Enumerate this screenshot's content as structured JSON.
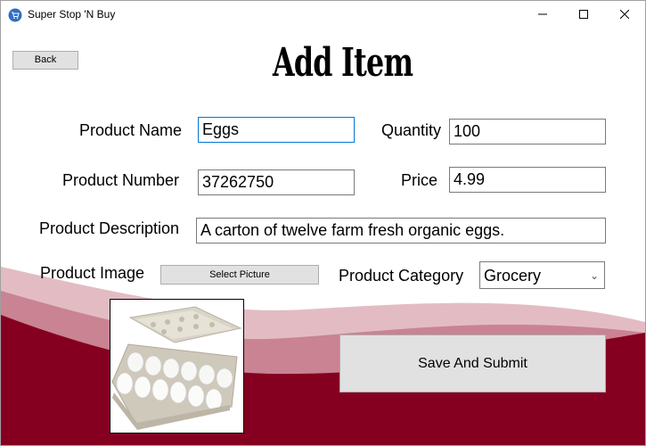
{
  "window": {
    "title": "Super Stop 'N Buy",
    "controls": [
      "minimize",
      "maximize",
      "close"
    ]
  },
  "header": {
    "back_label": "Back",
    "title": "Add Item"
  },
  "form": {
    "product_name": {
      "label": "Product Name",
      "value": "Eggs"
    },
    "quantity": {
      "label": "Quantity",
      "value": "100"
    },
    "product_number": {
      "label": "Product Number",
      "value": "37262750"
    },
    "price": {
      "label": "Price",
      "value": "4.99"
    },
    "product_description": {
      "label": "Product Description",
      "value": "A carton of twelve farm fresh organic eggs."
    },
    "product_image": {
      "label": "Product Image",
      "button_label": "Select Picture",
      "image_icon": "egg-carton-image"
    },
    "product_category": {
      "label": "Product Category",
      "selected": "Grocery"
    },
    "submit_label": "Save And Submit"
  },
  "colors": {
    "wave_light": "#e3bcc3",
    "wave_mid": "#c98392",
    "wave_dark": "#850020",
    "focus_border": "#0078d7"
  }
}
